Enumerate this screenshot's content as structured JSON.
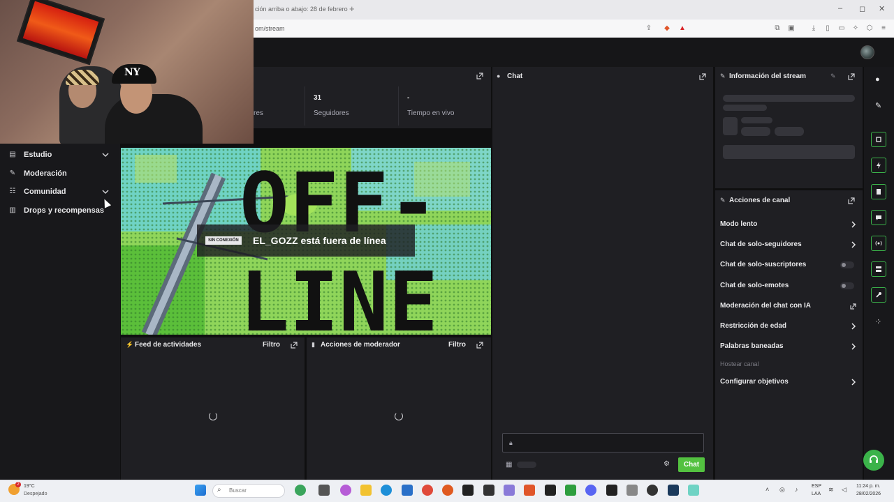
{
  "browser": {
    "tab_title": "ción arriba o abajo: 28 de febrero",
    "new_tab": "+",
    "url": "om/stream",
    "window_min": "–",
    "window_max": "◻",
    "window_close": "✕"
  },
  "sidebar": {
    "items": [
      {
        "label": "Estudio",
        "icon": "studio-icon",
        "expandable": true
      },
      {
        "label": "Moderación",
        "icon": "wrench-icon",
        "expandable": false
      },
      {
        "label": "Comunidad",
        "icon": "community-icon",
        "expandable": true
      },
      {
        "label": "Drops y recompensas",
        "icon": "gift-icon",
        "expandable": false
      }
    ]
  },
  "stats": {
    "label1_partial": "res",
    "followers_value": "31",
    "followers_label": "Seguidores",
    "live_time_value": "-",
    "live_time_label": "Tiempo en vivo"
  },
  "player": {
    "offline_tag": "SIN CONEXIÓN",
    "offline_text": "EL_GOZZ está fuera de línea",
    "art_line1": "OFF-",
    "art_line2": "LINE"
  },
  "feed": {
    "title": "Feed de actividades",
    "filter": "Filtro"
  },
  "mod_actions": {
    "title": "Acciones de moderador",
    "filter": "Filtro"
  },
  "chat": {
    "title": "Chat",
    "send_label": "Chat"
  },
  "stream_info": {
    "title": "Información del stream"
  },
  "channel_actions": {
    "title": "Acciones de canal",
    "rows": [
      {
        "label": "Modo lento",
        "control": "chevron"
      },
      {
        "label": "Chat de solo-seguidores",
        "control": "chevron"
      },
      {
        "label": "Chat de solo-suscriptores",
        "control": "toggle"
      },
      {
        "label": "Chat de solo-emotes",
        "control": "toggle"
      },
      {
        "label": "Moderación del chat con IA",
        "control": "external"
      },
      {
        "label": "Restricción de edad",
        "control": "chevron"
      },
      {
        "label": "Palabras baneadas",
        "control": "chevron"
      },
      {
        "label": "Hostear canal",
        "control": "none"
      },
      {
        "label": "Configurar objetivos",
        "control": "chevron"
      }
    ]
  },
  "taskbar": {
    "weather_badge": "2",
    "weather_temp": "19°C",
    "weather_desc": "Despejado",
    "search_placeholder": "Buscar",
    "lang1": "ESP",
    "lang2": "LAA",
    "time": "11:24 p. m.",
    "date": "28/02/2026"
  },
  "colors": {
    "accent": "#3bb34a",
    "chat_button": "#53c140",
    "panel": "#1f1f23"
  }
}
